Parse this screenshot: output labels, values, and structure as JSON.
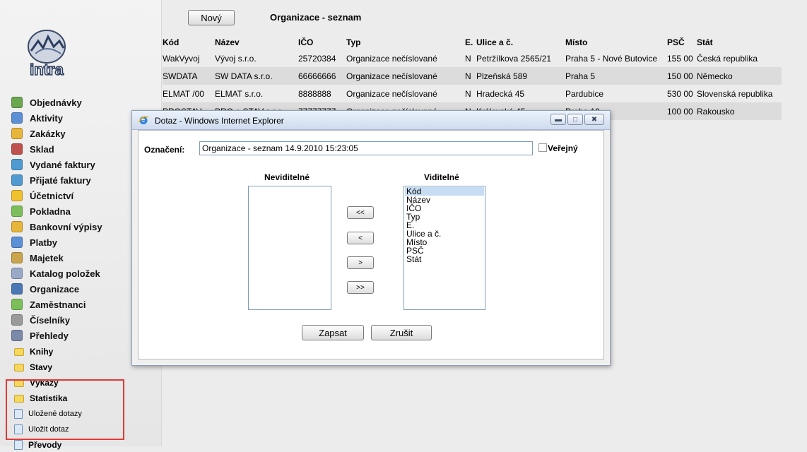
{
  "toolbar": {
    "new_label": "Nový",
    "page_title": "Organizace - seznam"
  },
  "table": {
    "columns": [
      "Kód",
      "Název",
      "IČO",
      "Typ",
      "E.",
      "Ulice a č.",
      "Místo",
      "PSČ",
      "Stát"
    ],
    "rows": [
      [
        "WakVyvoj",
        "Vývoj s.r.o.",
        "25720384",
        "Organizace nečíslované",
        "N",
        "Petržílkova 2565/21",
        "Praha 5 - Nové Butovice",
        "155 00",
        "Česká republika"
      ],
      [
        "SWDATA",
        "SW DATA s.r.o.",
        "66666666",
        "Organizace nečíslované",
        "N",
        "Plzeňská 589",
        "Praha 5",
        "150 00",
        "Německo"
      ],
      [
        "ELMAT /00",
        "ELMAT s.r.o.",
        "8888888",
        "Organizace nečíslované",
        "N",
        "Hradecká 45",
        "Pardubice",
        "530 00",
        "Slovenská republika"
      ],
      [
        "PROSTAV",
        "PRO + STAV s.r.o.",
        "77777777",
        "Organizace nečíslované",
        "N",
        "Královská 45",
        "Praha 10",
        "100 00",
        "Rakousko"
      ]
    ]
  },
  "sidebar": {
    "menu": [
      {
        "label": "Objednávky",
        "icon": "orders-icon",
        "color": "#6aa84f"
      },
      {
        "label": "Aktivity",
        "icon": "activities-icon",
        "color": "#5b8fd6"
      },
      {
        "label": "Zakázky",
        "icon": "jobs-icon",
        "color": "#e8b53b"
      },
      {
        "label": "Sklad",
        "icon": "warehouse-icon",
        "color": "#c0504d"
      },
      {
        "label": "Vydané faktury",
        "icon": "issued-invoices-icon",
        "color": "#4f9bd1"
      },
      {
        "label": "Přijaté faktury",
        "icon": "received-invoices-icon",
        "color": "#4f9bd1"
      },
      {
        "label": "Účetnictví",
        "icon": "accounting-icon",
        "color": "#f2c12e"
      },
      {
        "label": "Pokladna",
        "icon": "cash-desk-icon",
        "color": "#7cbf5a"
      },
      {
        "label": "Bankovní výpisy",
        "icon": "bank-statements-icon",
        "color": "#e8b53b"
      },
      {
        "label": "Platby",
        "icon": "payments-icon",
        "color": "#5b8fd6"
      },
      {
        "label": "Majetek",
        "icon": "property-icon",
        "color": "#c9a44a"
      },
      {
        "label": "Katalog položek",
        "icon": "catalog-icon",
        "color": "#9aa9c8"
      },
      {
        "label": "Organizace",
        "icon": "organizations-icon",
        "color": "#4a78b5"
      },
      {
        "label": "Zaměstnanci",
        "icon": "employees-icon",
        "color": "#7cbf5a"
      },
      {
        "label": "Číselníky",
        "icon": "codebooks-icon",
        "color": "#9a9a9a"
      },
      {
        "label": "Přehledy",
        "icon": "overviews-icon",
        "color": "#7a8aa8"
      }
    ],
    "sub": [
      {
        "label": "Knihy",
        "icon": "folder-icon"
      },
      {
        "label": "Stavy",
        "icon": "folder-icon"
      },
      {
        "label": "Výkazy",
        "icon": "folder-icon"
      },
      {
        "label": "Statistika",
        "icon": "folder-icon"
      },
      {
        "label": "Uložené dotazy",
        "icon": "saved-queries-icon"
      },
      {
        "label": "Uložit dotaz",
        "icon": "save-query-icon"
      },
      {
        "label": "Převody",
        "icon": "transfers-icon"
      }
    ]
  },
  "dialog": {
    "title": "Dotaz - Windows Internet Explorer",
    "label_oznaceni": "Označení:",
    "oznaceni_value": "Organizace - seznam 14.9.2010 15:23:05",
    "label_verejny": "Veřejný",
    "verejny_checked": false,
    "header_neviditelne": "Neviditelné",
    "header_viditelne": "Viditelné",
    "neviditelne": [],
    "viditelne": [
      "Kód",
      "Název",
      "IČO",
      "Typ",
      "E.",
      "Ulice a č.",
      "Místo",
      "PSČ",
      "Stát"
    ],
    "selected_visible": "Kód",
    "btn_move_all_left": "<<",
    "btn_move_left": "<",
    "btn_move_right": ">",
    "btn_move_all_right": ">>",
    "btn_zapsat": "Zapsat",
    "btn_zrusit": "Zrušit"
  },
  "colors": {
    "highlight_box": "#e53935",
    "selection": "#c7ddf3",
    "alt_row": "#dcdcdc"
  }
}
